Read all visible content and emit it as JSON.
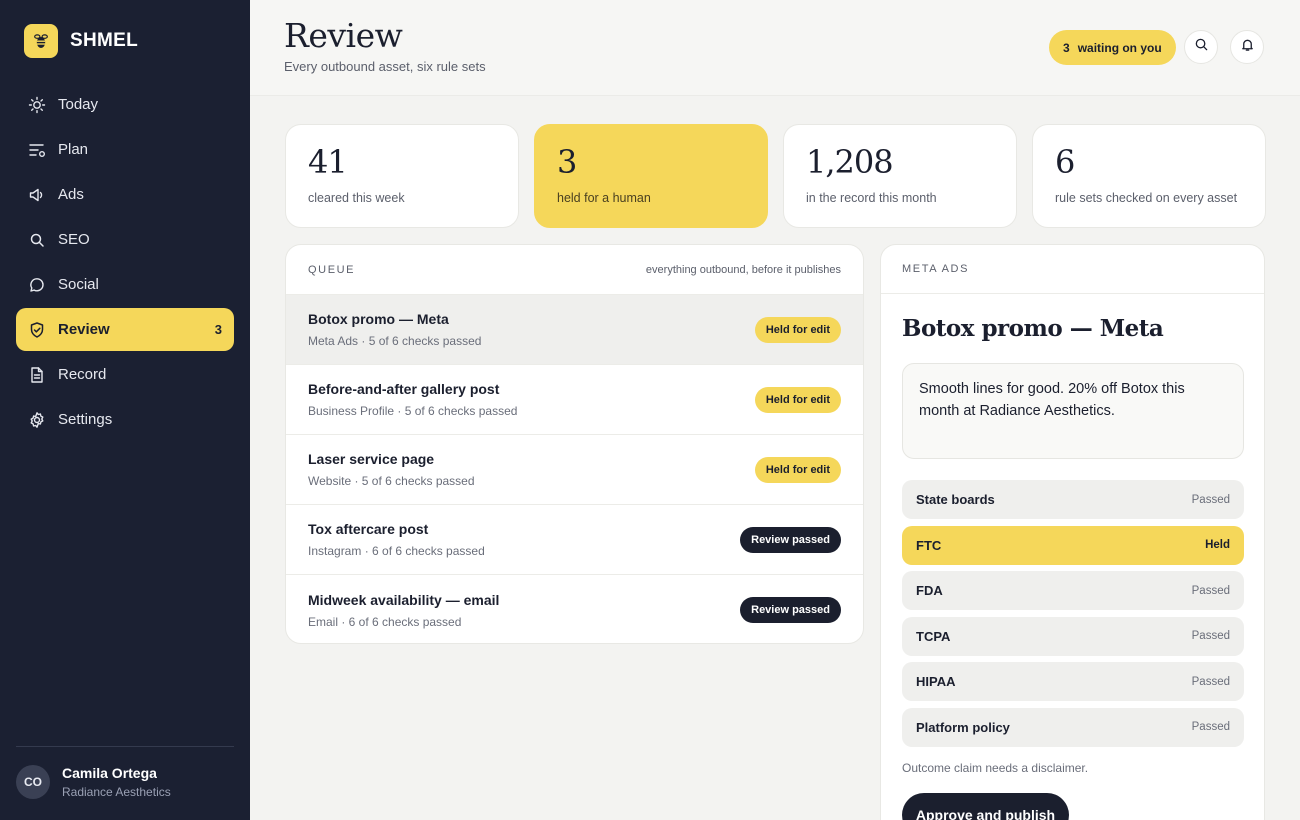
{
  "app": {
    "name": "SHMEL",
    "logo_icon": "bee-icon"
  },
  "sidebar": {
    "items": [
      {
        "label": "Today",
        "icon": "sun-icon",
        "count": ""
      },
      {
        "label": "Plan",
        "icon": "plan-list-icon",
        "count": ""
      },
      {
        "label": "Ads",
        "icon": "megaphone-icon",
        "count": ""
      },
      {
        "label": "SEO",
        "icon": "search-icon",
        "count": ""
      },
      {
        "label": "Social",
        "icon": "chat-bubble-icon",
        "count": ""
      },
      {
        "label": "Review",
        "icon": "shield-icon",
        "count": "3",
        "active": true
      },
      {
        "label": "Record",
        "icon": "document-icon",
        "count": ""
      },
      {
        "label": "Settings",
        "icon": "gear-icon",
        "count": ""
      }
    ],
    "user": {
      "initials": "CO",
      "name": "Camila Ortega",
      "org": "Radiance Aesthetics"
    }
  },
  "header": {
    "title": "Review",
    "subtitle": "Every outbound asset, six rule sets",
    "waiting_count": "3",
    "waiting_label": "waiting on you"
  },
  "stats": [
    {
      "value": "41",
      "label": "cleared this week"
    },
    {
      "value": "3",
      "label": "held for a human",
      "highlight": true
    },
    {
      "value": "1,208",
      "label": "in the record this month"
    },
    {
      "value": "6",
      "label": "rule sets checked on every asset"
    }
  ],
  "queue": {
    "title": "QUEUE",
    "note": "everything outbound, before it publishes",
    "items": [
      {
        "title": "Botox promo — Meta",
        "meta": "Meta Ads · 5 of 6 checks passed",
        "status": "Held for edit",
        "selected": true
      },
      {
        "title": "Before-and-after gallery post",
        "meta": "Business Profile · 5 of 6 checks passed",
        "status": "Held for edit"
      },
      {
        "title": "Laser service page",
        "meta": "Website · 5 of 6 checks passed",
        "status": "Held for edit"
      },
      {
        "title": "Tox aftercare post",
        "meta": "Instagram · 6 of 6 checks passed",
        "status": "Review passed"
      },
      {
        "title": "Midweek availability — email",
        "meta": "Email · 6 of 6 checks passed",
        "status": "Review passed"
      }
    ]
  },
  "detail": {
    "channel": "META ADS",
    "title": "Botox promo — Meta",
    "copy": "Smooth lines for good. 20% off Botox this month at Radiance Aesthetics.",
    "rules": [
      {
        "name": "State boards",
        "status": "Passed"
      },
      {
        "name": "FTC",
        "status": "Held"
      },
      {
        "name": "FDA",
        "status": "Passed"
      },
      {
        "name": "TCPA",
        "status": "Passed"
      },
      {
        "name": "HIPAA",
        "status": "Passed"
      },
      {
        "name": "Platform policy",
        "status": "Passed"
      }
    ],
    "note": "Outcome claim needs a disclaimer.",
    "approve_label": "Approve and publish"
  },
  "colors": {
    "accent": "#f5d75a",
    "sidebar_bg": "#1b2032",
    "dark": "#1b1f2e"
  }
}
